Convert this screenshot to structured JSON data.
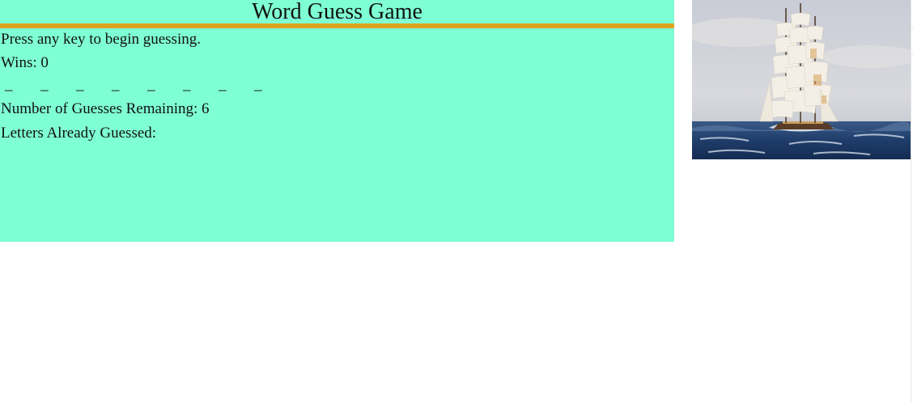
{
  "game": {
    "title": "Word Guess Game",
    "prompt": "Press any key to begin guessing.",
    "wins_label": "Wins:",
    "wins": "0",
    "word_blanks": [
      "_",
      "_",
      "_",
      "_",
      "_",
      "_",
      "_",
      "_"
    ],
    "guesses_label": "Number of Guesses Remaining:",
    "guesses_remaining": "6",
    "letters_guessed_label": "Letters Already Guessed:",
    "letters_guessed": ""
  },
  "colors": {
    "panel_background": "#7fffd4",
    "title_rule": "#daa520"
  },
  "image": {
    "subject": "clipper-ship-painting"
  }
}
